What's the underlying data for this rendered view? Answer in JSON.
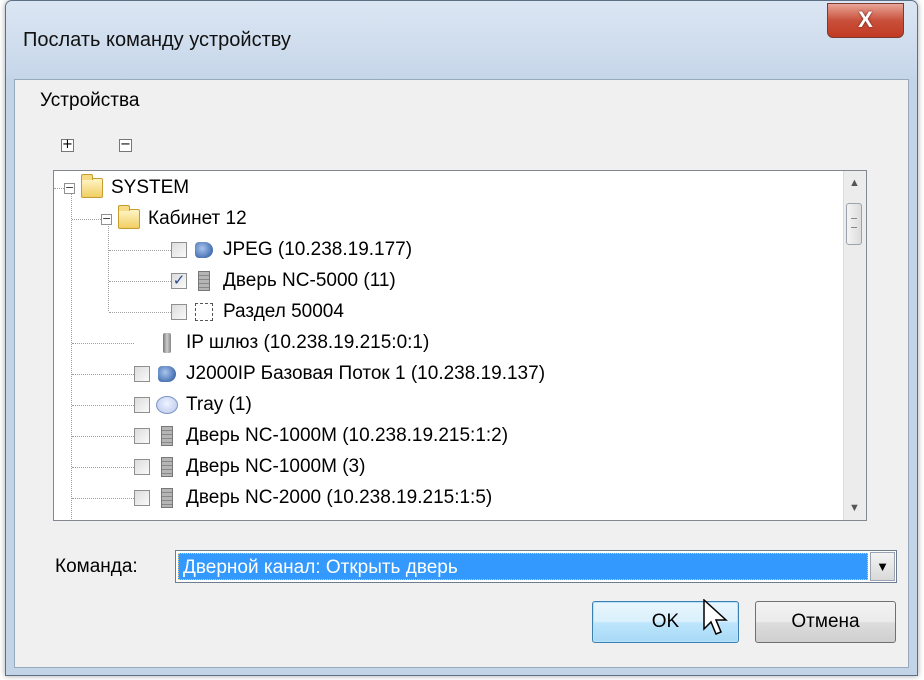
{
  "window": {
    "title": "Послать команду устройству",
    "close_label": "X"
  },
  "devices_group": {
    "label": "Устройства",
    "expand_all": "+",
    "collapse_all": "−"
  },
  "tree": {
    "nodes": [
      {
        "label": "SYSTEM",
        "level": 0,
        "expander": "−",
        "checkbox": false,
        "checked": false,
        "icon": "folder-icon"
      },
      {
        "label": "Кабинет 12",
        "level": 1,
        "expander": "−",
        "checkbox": false,
        "checked": false,
        "icon": "folder-icon"
      },
      {
        "label": "JPEG (10.238.19.177)",
        "level": 2,
        "expander": "",
        "checkbox": true,
        "checked": false,
        "icon": "camera-icon"
      },
      {
        "label": "Дверь NC-5000 (11)",
        "level": 2,
        "expander": "",
        "checkbox": true,
        "checked": true,
        "icon": "door-icon"
      },
      {
        "label": "Раздел 50004",
        "level": 2,
        "expander": "",
        "checkbox": true,
        "checked": false,
        "icon": "section-icon"
      },
      {
        "label": "IP шлюз (10.238.19.215:0:1)",
        "level": 1,
        "expander": "",
        "checkbox": false,
        "checked": false,
        "icon": "gateway-icon"
      },
      {
        "label": "J2000IP Базовая Поток 1 (10.238.19.137)",
        "level": 1,
        "expander": "",
        "checkbox": true,
        "checked": false,
        "icon": "camera-icon"
      },
      {
        "label": "Tray (1)",
        "level": 1,
        "expander": "",
        "checkbox": true,
        "checked": false,
        "icon": "tray-icon"
      },
      {
        "label": "Дверь NC-1000M (10.238.19.215:1:2)",
        "level": 1,
        "expander": "",
        "checkbox": true,
        "checked": false,
        "icon": "door-icon"
      },
      {
        "label": "Дверь NC-1000M (3)",
        "level": 1,
        "expander": "",
        "checkbox": true,
        "checked": false,
        "icon": "door-icon"
      },
      {
        "label": "Дверь NC-2000 (10.238.19.215:1:5)",
        "level": 1,
        "expander": "",
        "checkbox": true,
        "checked": false,
        "icon": "door-icon"
      }
    ]
  },
  "command": {
    "label": "Команда:",
    "selected": "Дверной канал: Открыть дверь"
  },
  "buttons": {
    "ok": "OK",
    "cancel": "Отмена"
  },
  "colors": {
    "selection": "#3399ff",
    "frame": "#c3d4e7",
    "close": "#c8503b"
  }
}
